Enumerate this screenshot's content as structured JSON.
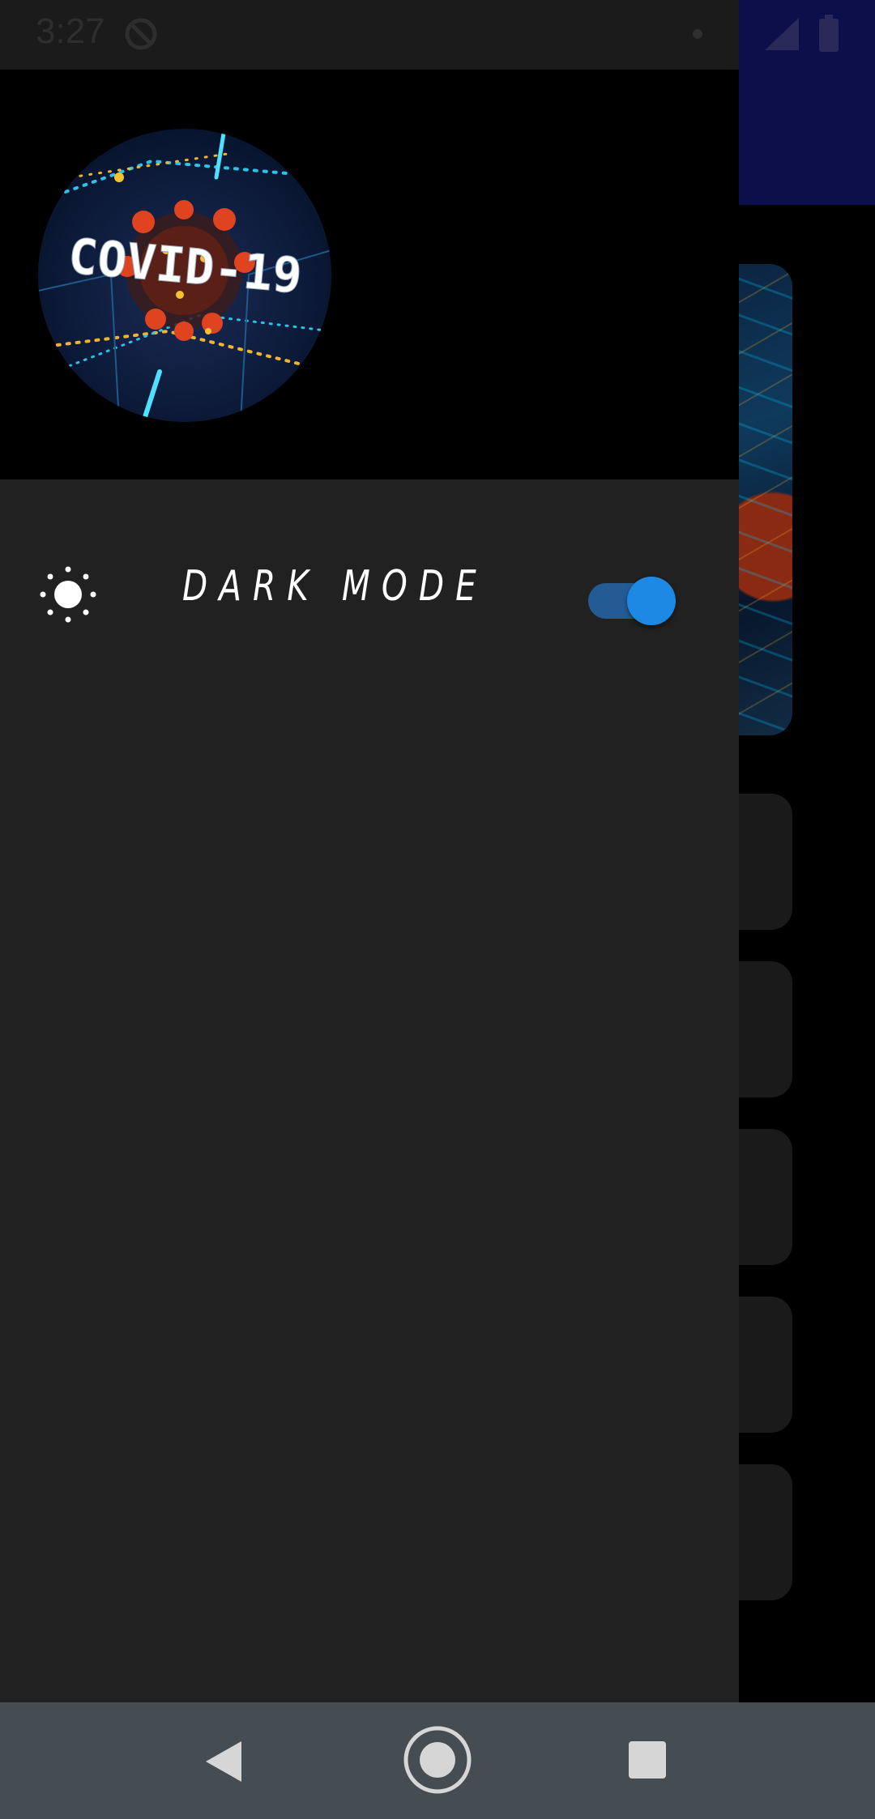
{
  "status_bar": {
    "time": "3:27",
    "icons": [
      "sync-disabled-icon",
      "notification-dot-icon",
      "signal-icon",
      "battery-icon"
    ]
  },
  "drawer": {
    "logo": {
      "text": "COVID-19",
      "icon": "covid-19-logo"
    },
    "dark_mode": {
      "icon": "sun-icon",
      "label": "DARK MODE",
      "enabled": true
    }
  },
  "nav_bar": {
    "icons": [
      "back-icon",
      "home-icon",
      "recents-icon"
    ]
  },
  "colors": {
    "drawer_bg": "#212121",
    "header_bg": "#000000",
    "toolbar": "#0d0f4a",
    "toggle_thumb": "#1e88e5",
    "toggle_track": "#235c95",
    "nav_bar": "#454d52"
  }
}
